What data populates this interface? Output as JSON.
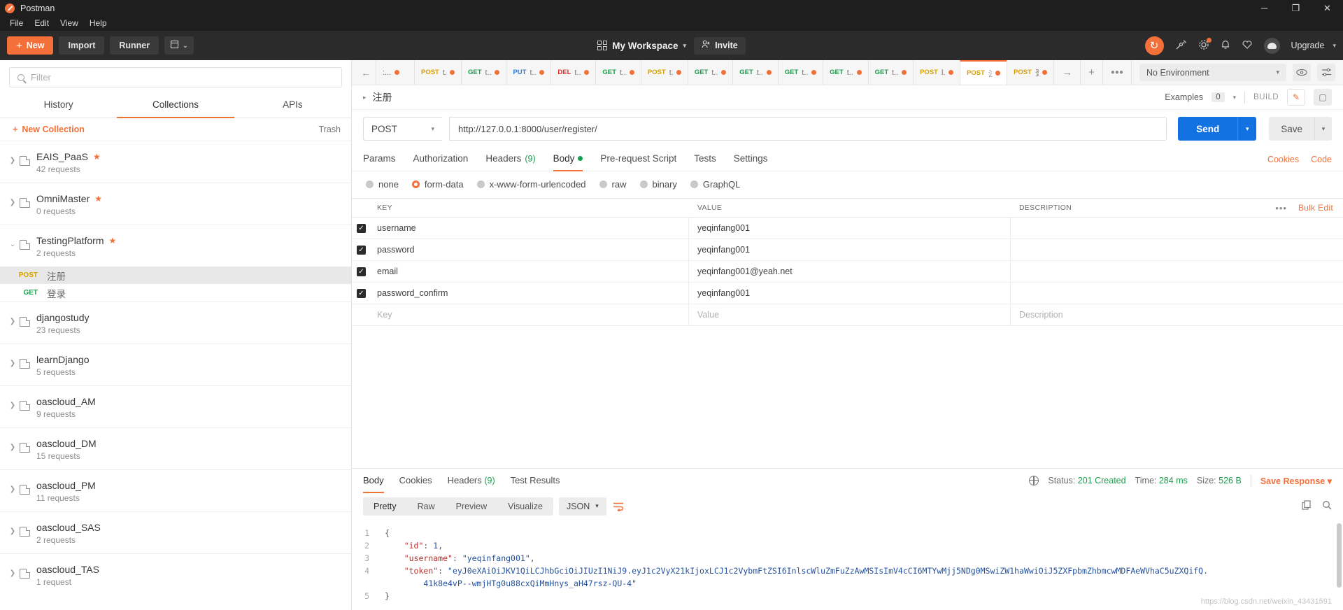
{
  "window": {
    "title": "Postman",
    "minimize": "─",
    "maximize": "❐",
    "close": "✕"
  },
  "menu": [
    "File",
    "Edit",
    "View",
    "Help"
  ],
  "toolbar": {
    "new_label": "New",
    "new_plus": "+",
    "import_label": "Import",
    "runner_label": "Runner",
    "new_window_caret": "⌄",
    "workspace_label": "My Workspace",
    "workspace_caret": "▾",
    "invite_label": "Invite",
    "invite_icon": "person-plus-icon",
    "sync_icon": "↻",
    "upgrade_label": "Upgrade",
    "upgrade_caret": "▾"
  },
  "sidebar": {
    "filter_placeholder": "Filter",
    "tabs": [
      {
        "label": "History",
        "active": false
      },
      {
        "label": "Collections",
        "active": true
      },
      {
        "label": "APIs",
        "active": false
      }
    ],
    "new_collection_label": "New Collection",
    "new_collection_plus": "+",
    "trash_label": "Trash",
    "collections": [
      {
        "name": "EAIS_PaaS",
        "count": "42 requests",
        "starred": true,
        "expanded": false
      },
      {
        "name": "OmniMaster",
        "count": "0 requests",
        "starred": true,
        "expanded": false
      },
      {
        "name": "TestingPlatform",
        "count": "2 requests",
        "starred": true,
        "expanded": true
      },
      {
        "name": "djangostudy",
        "count": "23 requests",
        "starred": false,
        "expanded": false
      },
      {
        "name": "learnDjango",
        "count": "5 requests",
        "starred": false,
        "expanded": false
      },
      {
        "name": "oascloud_AM",
        "count": "9 requests",
        "starred": false,
        "expanded": false
      },
      {
        "name": "oascloud_DM",
        "count": "15 requests",
        "starred": false,
        "expanded": false
      },
      {
        "name": "oascloud_PM",
        "count": "11 requests",
        "starred": false,
        "expanded": false
      },
      {
        "name": "oascloud_SAS",
        "count": "2 requests",
        "starred": false,
        "expanded": false
      },
      {
        "name": "oascloud_TAS",
        "count": "1 request",
        "starred": false,
        "expanded": false
      }
    ],
    "requests": [
      {
        "method": "POST",
        "name": "注册",
        "selected": true
      },
      {
        "method": "GET",
        "name": "登录",
        "selected": false
      }
    ]
  },
  "tabstrip": {
    "back_arrow": "←",
    "forward_arrow": "→",
    "plus": "+",
    "more": "●●●",
    "tabs": [
      {
        "method": "",
        "title": ":...",
        "cls": "post",
        "active": false
      },
      {
        "method": "POST",
        "title": "t...",
        "cls": "post",
        "active": false
      },
      {
        "method": "GET",
        "title": "t...",
        "cls": "get",
        "active": false
      },
      {
        "method": "PUT",
        "title": "t...",
        "cls": "put",
        "active": false
      },
      {
        "method": "DEL",
        "title": "t...",
        "cls": "del",
        "active": false
      },
      {
        "method": "GET",
        "title": "t...",
        "cls": "get",
        "active": false
      },
      {
        "method": "POST",
        "title": "t...",
        "cls": "post",
        "active": false
      },
      {
        "method": "GET",
        "title": "t...",
        "cls": "get",
        "active": false
      },
      {
        "method": "GET",
        "title": "t...",
        "cls": "get",
        "active": false
      },
      {
        "method": "GET",
        "title": "t...",
        "cls": "get",
        "active": false
      },
      {
        "method": "GET",
        "title": "t...",
        "cls": "get",
        "active": false
      },
      {
        "method": "GET",
        "title": "t...",
        "cls": "get",
        "active": false
      },
      {
        "method": "POST",
        "title": "l...",
        "cls": "post",
        "active": false
      },
      {
        "method": "POST",
        "title": "注",
        "cls": "post",
        "active": true
      },
      {
        "method": "POST",
        "title": "登",
        "cls": "post",
        "active": false
      }
    ],
    "environment": "No Environment",
    "env_caret": "▾",
    "eye_icon": "◉",
    "settings_icon": "≡"
  },
  "request": {
    "breadcrumb_caret": "▸",
    "name": "注册",
    "examples_label": "Examples",
    "examples_count": "0",
    "examples_caret": "▾",
    "build_label": "BUILD",
    "edit_icon": "✎",
    "comment_icon": "▢",
    "method": "POST",
    "method_caret": "▾",
    "url": "http://127.0.0.1:8000/user/register/",
    "send_label": "Send",
    "send_caret": "▾",
    "save_label": "Save",
    "save_caret": "▾",
    "tabs": [
      {
        "label": "Params",
        "active": false,
        "badge": "",
        "dot": false
      },
      {
        "label": "Authorization",
        "active": false,
        "badge": "",
        "dot": false
      },
      {
        "label": "Headers",
        "active": false,
        "badge": "(9)",
        "dot": false
      },
      {
        "label": "Body",
        "active": true,
        "badge": "",
        "dot": true
      },
      {
        "label": "Pre-request Script",
        "active": false,
        "badge": "",
        "dot": false
      },
      {
        "label": "Tests",
        "active": false,
        "badge": "",
        "dot": false
      },
      {
        "label": "Settings",
        "active": false,
        "badge": "",
        "dot": false
      }
    ],
    "cookies_link": "Cookies",
    "code_link": "Code",
    "body_types": [
      {
        "label": "none",
        "selected": false
      },
      {
        "label": "form-data",
        "selected": true
      },
      {
        "label": "x-www-form-urlencoded",
        "selected": false
      },
      {
        "label": "raw",
        "selected": false
      },
      {
        "label": "binary",
        "selected": false
      },
      {
        "label": "GraphQL",
        "selected": false
      }
    ],
    "table": {
      "headers": [
        "KEY",
        "VALUE",
        "DESCRIPTION"
      ],
      "dots": "•••",
      "bulk_edit": "Bulk Edit",
      "rows": [
        {
          "checked": true,
          "key": "username",
          "value": "yeqinfang001",
          "description": ""
        },
        {
          "checked": true,
          "key": "password",
          "value": "yeqinfang001",
          "description": ""
        },
        {
          "checked": true,
          "key": "email",
          "value": "yeqinfang001@yeah.net",
          "description": ""
        },
        {
          "checked": true,
          "key": "password_confirm",
          "value": "yeqinfang001",
          "description": ""
        }
      ],
      "placeholder_row": {
        "key": "Key",
        "value": "Value",
        "description": "Description"
      }
    }
  },
  "response": {
    "tabs": [
      {
        "label": "Body",
        "active": true,
        "badge": ""
      },
      {
        "label": "Cookies",
        "active": false,
        "badge": ""
      },
      {
        "label": "Headers",
        "active": false,
        "badge": "(9)"
      },
      {
        "label": "Test Results",
        "active": false,
        "badge": ""
      }
    ],
    "status_label": "Status:",
    "status_value": "201 Created",
    "time_label": "Time:",
    "time_value": "284 ms",
    "size_label": "Size:",
    "size_value": "526 B",
    "save_response": "Save Response",
    "save_response_caret": "▾",
    "formats": [
      "Pretty",
      "Raw",
      "Preview",
      "Visualize"
    ],
    "format_selected": "Pretty",
    "language": "JSON",
    "language_caret": "▾",
    "wrap_icon": "↩",
    "copy_icon": "⧉",
    "search_icon": "search-icon",
    "line_numbers": [
      "1",
      "2",
      "3",
      "4",
      "5"
    ],
    "body_lines": [
      {
        "indent": 0,
        "parts": [
          {
            "t": "{",
            "c": "p"
          }
        ]
      },
      {
        "indent": 1,
        "parts": [
          {
            "t": "\"id\"",
            "c": "k"
          },
          {
            "t": ": ",
            "c": "p"
          },
          {
            "t": "1",
            "c": "n"
          },
          {
            "t": ",",
            "c": "p"
          }
        ]
      },
      {
        "indent": 1,
        "parts": [
          {
            "t": "\"username\"",
            "c": "k"
          },
          {
            "t": ": ",
            "c": "p"
          },
          {
            "t": "\"yeqinfang001\"",
            "c": "s"
          },
          {
            "t": ",",
            "c": "p"
          }
        ]
      },
      {
        "indent": 1,
        "parts": [
          {
            "t": "\"token\"",
            "c": "k"
          },
          {
            "t": ": ",
            "c": "p"
          },
          {
            "t": "\"eyJ0eXAiOiJKV1QiLCJhbGciOiJIUzI1NiJ9.eyJ1c2VyX21kIjoxLCJ1c2VybmFtZSI6InlscWluZmFuZzAwMSIsImV4cCI6MTYwMjj5NDg0MSwiZW1haWwiOiJ5ZXFpbmZhbmcwMDFAeWVhaC5uZXQifQ.",
            "c": "s"
          }
        ]
      },
      {
        "indent": 2,
        "parts": [
          {
            "t": "41k8e4vP--wmjHTg0u88cxQiMmHnys_aH47rsz-QU-4\"",
            "c": "s"
          }
        ]
      },
      {
        "indent": 0,
        "parts": [
          {
            "t": "}",
            "c": "p"
          }
        ]
      }
    ],
    "watermark": "https://blog.csdn.net/weixin_43431591"
  }
}
